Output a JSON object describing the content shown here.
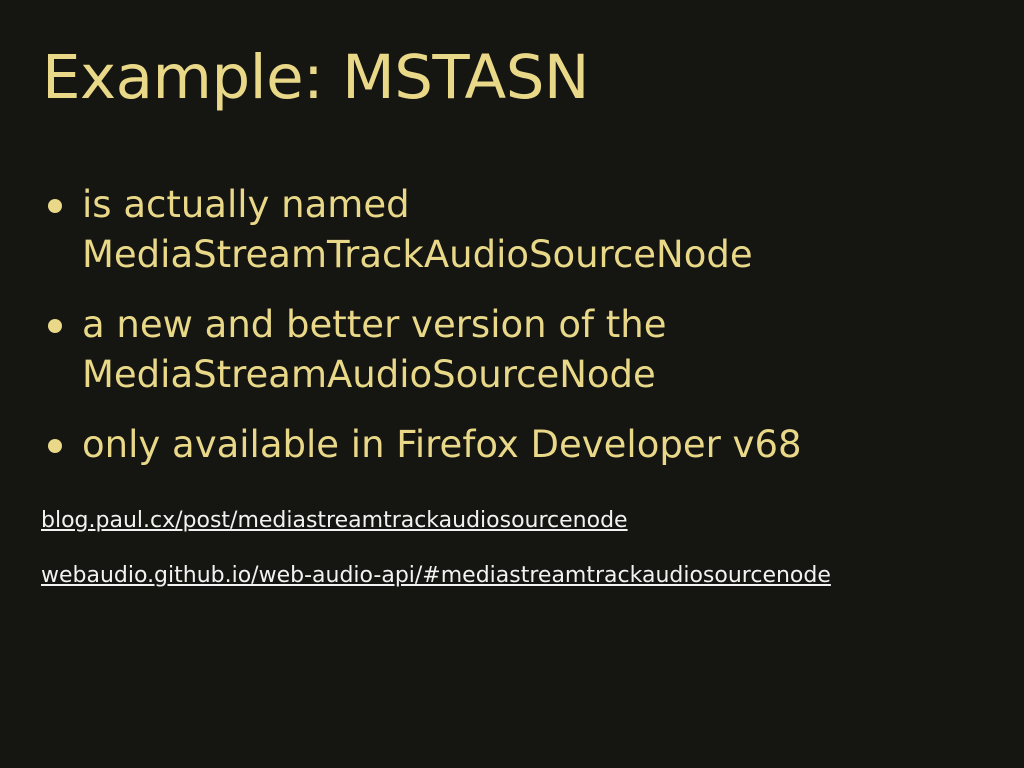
{
  "slide": {
    "title": "Example: MSTASN",
    "bullets": [
      {
        "line1": "is actually named",
        "line2": "MediaStreamTrackAudioSourceNode"
      },
      {
        "line1": "a new and better version of the",
        "line2": "MediaStreamAudioSourceNode"
      },
      {
        "line1": "only available in Firefox Developer v68"
      }
    ],
    "links": [
      "blog.paul.cx/post/mediastreamtrackaudiosourcenode",
      "webaudio.github.io/web-audio-api/#mediastreamtrackaudiosourcenode"
    ]
  },
  "colors": {
    "background": "#151512",
    "accent": "#e8d888",
    "link": "#f2f2f2"
  }
}
